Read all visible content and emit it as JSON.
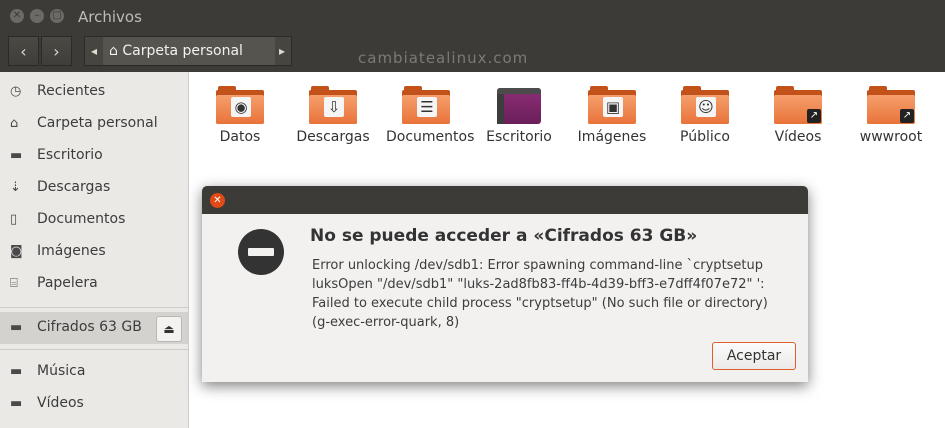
{
  "window": {
    "title": "Archivos"
  },
  "toolbar": {
    "back_label": "‹",
    "forward_label": "›",
    "path_left": "◂",
    "path_right": "▸",
    "path_home_label": "Carpeta personal",
    "watermark": "cambiatealinux.com"
  },
  "sidebar": {
    "items": [
      {
        "label": "Recientes",
        "icon": "clock-icon"
      },
      {
        "label": "Carpeta personal",
        "icon": "home-icon"
      },
      {
        "label": "Escritorio",
        "icon": "folder-icon"
      },
      {
        "label": "Descargas",
        "icon": "download-icon"
      },
      {
        "label": "Documentos",
        "icon": "document-icon"
      },
      {
        "label": "Imágenes",
        "icon": "camera-icon"
      },
      {
        "label": "Papelera",
        "icon": "trash-icon"
      }
    ],
    "device": {
      "label": "Cifrados 63 GB",
      "icon": "drive-icon"
    },
    "bookmarks": [
      {
        "label": "Música",
        "icon": "folder-icon"
      },
      {
        "label": "Vídeos",
        "icon": "folder-icon"
      }
    ]
  },
  "files": [
    {
      "name": "Datos"
    },
    {
      "name": "Descargas"
    },
    {
      "name": "Documentos"
    },
    {
      "name": "Escritorio"
    },
    {
      "name": "Imágenes"
    },
    {
      "name": "Público"
    },
    {
      "name": "Vídeos"
    },
    {
      "name": "wwwroot"
    }
  ],
  "dialog": {
    "heading": "No se puede acceder a «Cifrados 63 GB»",
    "message": "Error unlocking /dev/sdb1: Error spawning command-line `cryptsetup luksOpen \"/dev/sdb1\" \"luks-2ad8fb83-ff4b-4d39-bff3-e7dff4f07e72\" ': Failed to execute child process \"cryptsetup\" (No such file or directory) (g-exec-error-quark, 8)",
    "accept_label": "Aceptar"
  },
  "colors": {
    "accent": "#e05e2e",
    "folder": "#e9733a",
    "titlebar": "#3c3b37"
  }
}
